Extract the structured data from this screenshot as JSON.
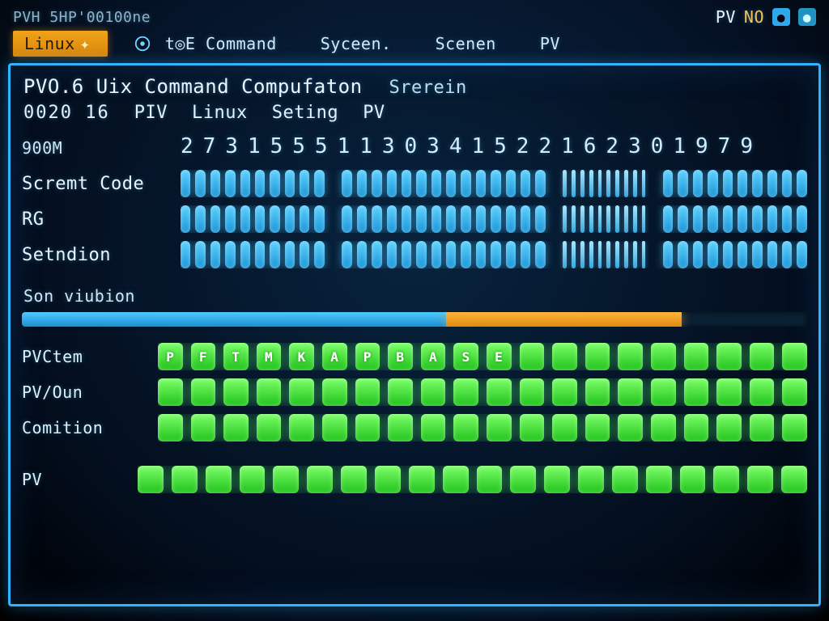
{
  "status": {
    "left": "PVH 5HP'00100ne",
    "right_indicator_1": "PV",
    "right_indicator_2": "NO"
  },
  "tabs": {
    "active": "Linux",
    "items": [
      "t◎E Command",
      "Syceen.",
      "Scenen",
      "PV"
    ]
  },
  "panel": {
    "title_main": "PVO.6 Uix Command Compufaton",
    "title_trail": "Srerein",
    "sub_numbers": "0020 16",
    "sub_items": [
      "PIV",
      "Linux",
      "Seting",
      "PV"
    ]
  },
  "matrix": {
    "header_digits": "27315551130341522162301979",
    "rows": [
      {
        "label": "900M",
        "caps": 0
      },
      {
        "label": "Scremt Code"
      },
      {
        "label": "RG"
      },
      {
        "label": "Setndion"
      }
    ],
    "cluster_sizes": [
      10,
      14,
      10
    ],
    "thin_cluster_size": 10
  },
  "progress": {
    "label": "Son viubion",
    "blue_pct": 54,
    "orange_pct": 30
  },
  "lower": {
    "rows": [
      "PVCtem",
      "PV/Oun",
      "Comition"
    ],
    "letters_row0": [
      "P",
      "F",
      "T",
      "M",
      "K",
      "A",
      "P",
      "B",
      "A",
      "S",
      "E",
      "",
      "",
      "",
      "",
      "",
      "",
      "",
      "",
      ""
    ],
    "blocks_per_row": 20
  },
  "footer": {
    "label": "PV",
    "blocks": 20
  },
  "colors": {
    "accent_blue": "#2fb4ff",
    "accent_orange": "#e89a1a",
    "accent_green": "#2fdc2a"
  }
}
